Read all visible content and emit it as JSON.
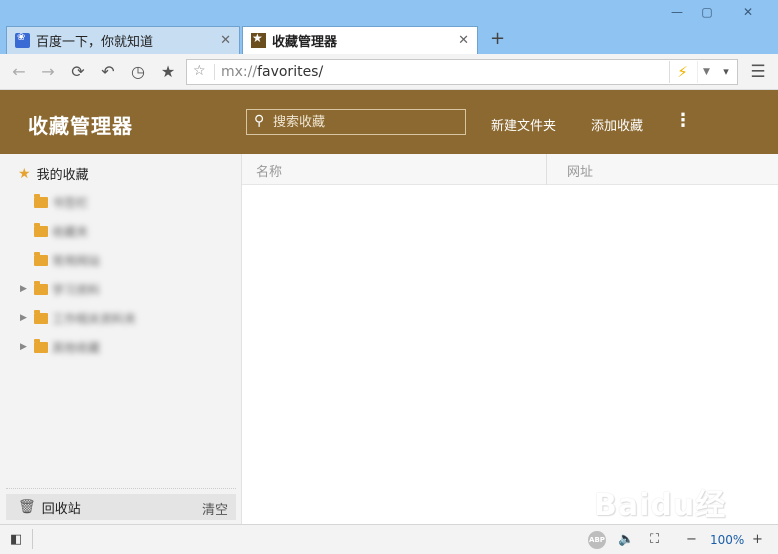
{
  "window": {
    "minimize_glyph": "—",
    "maximize_glyph": "▢",
    "close_glyph": "✕"
  },
  "tabs": [
    {
      "label": "百度一下，你就知道",
      "icon": "baidu-icon",
      "active": false
    },
    {
      "label": "收藏管理器",
      "icon": "favorites-star-icon",
      "active": true
    }
  ],
  "tab_close_glyph": "✕",
  "new_tab_glyph": "+",
  "nav": {
    "back_icon": "←",
    "forward_icon": "→",
    "reload_icon": "⟳",
    "undo_icon": "↶",
    "history_icon": "◷",
    "favorites_icon": "★",
    "more_icon": "▾",
    "menu_icon": "☰"
  },
  "address": {
    "star_glyph": "☆",
    "scheme": "mx://",
    "host": "favorites/",
    "bolt_glyph": "⚡",
    "dropdown_glyph": "▼"
  },
  "header": {
    "title": "收藏管理器",
    "search_placeholder": "搜索收藏",
    "search_icon_glyph": "⚲",
    "new_folder_label": "新建文件夹",
    "add_favorite_label": "添加收藏",
    "more_glyph": "⋮"
  },
  "sidebar": {
    "root_label": "我的收藏",
    "root_star": "★",
    "folders": [
      {
        "label": "书签栏",
        "expandable": false
      },
      {
        "label": "收藏夹",
        "expandable": false
      },
      {
        "label": "常用网站",
        "expandable": false
      },
      {
        "label": "学习资料",
        "expandable": true
      },
      {
        "label": "工作相关资料夹",
        "expandable": true
      },
      {
        "label": "其他收藏",
        "expandable": true
      }
    ],
    "arrow_glyph": "▶",
    "recycle_label": "回收站",
    "recycle_glyph": "🗑",
    "empty_label": "清空"
  },
  "table": {
    "columns": [
      "名称",
      "网址"
    ]
  },
  "watermark": {
    "text": "Baidu经验"
  },
  "status": {
    "sidebar_toggle_glyph": "◧",
    "adblock_label": "ABP",
    "sound_glyph": "🔈",
    "fullscreen_glyph": "⛶",
    "zoom_out_glyph": "−",
    "zoom_level": "100%",
    "zoom_in_glyph": "+"
  },
  "colors": {
    "header_bg": "#8b6931",
    "folder": "#e8a733",
    "titlebar": "#8fc3f2",
    "zoom_text": "#1a5ea8"
  }
}
